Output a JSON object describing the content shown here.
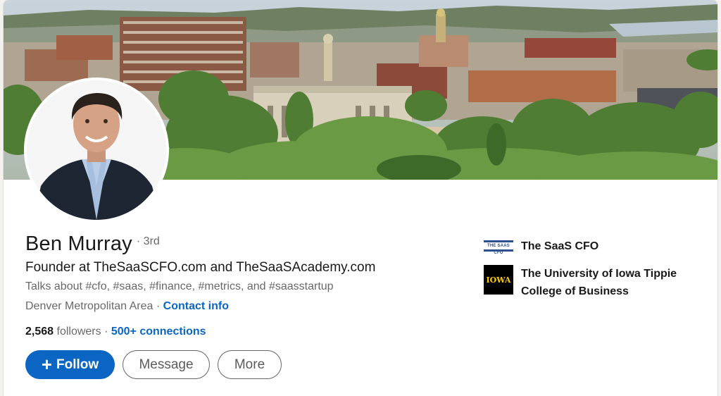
{
  "profile": {
    "name": "Ben Murray",
    "degree": "· 3rd",
    "headline": "Founder at TheSaaSCFO.com and TheSaaSAcademy.com",
    "talks_about": "Talks about #cfo, #saas, #finance, #metrics, and #saasstartup",
    "location": "Denver Metropolitan Area",
    "separator": " · ",
    "contact_info": "Contact info",
    "followers_count": "2,568",
    "followers_label": " followers",
    "dot": " · ",
    "connections": "500+ connections"
  },
  "actions": {
    "follow_icon": "plus-icon",
    "follow_symbol": "+",
    "follow_label": "Follow",
    "message_label": "Message",
    "more_label": "More"
  },
  "organizations": [
    {
      "name": "The SaaS CFO",
      "logo_text": "THE SAAS CFO",
      "logo_icon": "saas-cfo-logo"
    },
    {
      "name": "The University of Iowa Tippie College of Business",
      "logo_text": "IOWA",
      "logo_icon": "iowa-logo"
    }
  ],
  "colors": {
    "accent": "#0a66c2",
    "iowa_gold": "#ffcd00",
    "saas_blue": "#2d4f8e"
  }
}
